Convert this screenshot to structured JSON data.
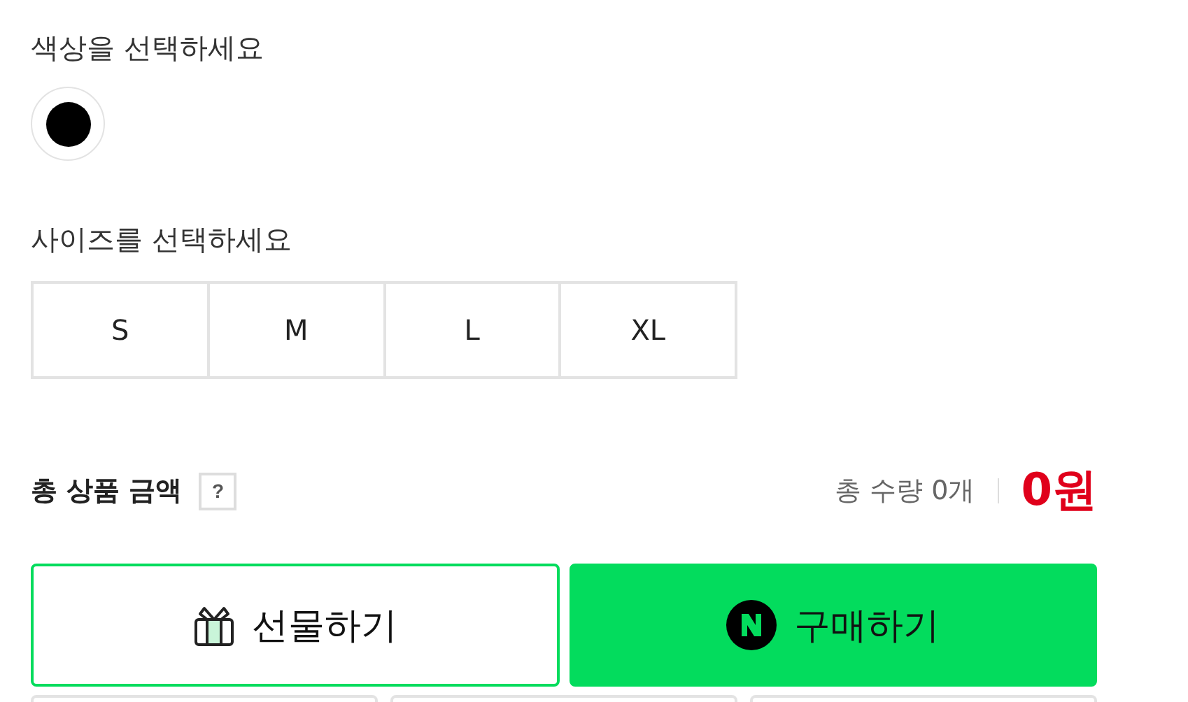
{
  "color_section": {
    "label": "색상을 선택하세요",
    "swatches": [
      {
        "color": "#000000",
        "selected": false
      }
    ]
  },
  "size_section": {
    "label": "사이즈를 선택하세요",
    "options": [
      {
        "label": "S",
        "selected": false
      },
      {
        "label": "M",
        "selected": false
      },
      {
        "label": "L",
        "selected": false
      },
      {
        "label": "XL",
        "selected": false
      }
    ]
  },
  "total": {
    "label": "총 상품 금액",
    "help": "?",
    "quantity": "총 수량 0개",
    "price": "0원"
  },
  "buttons": [
    {
      "kind": "gift",
      "label": "선물하기"
    },
    {
      "kind": "buy",
      "label": "구매하기"
    }
  ],
  "more_buttons": [
    {
      "kind": "outline"
    },
    {
      "kind": "outline"
    },
    {
      "kind": "outline"
    }
  ]
}
